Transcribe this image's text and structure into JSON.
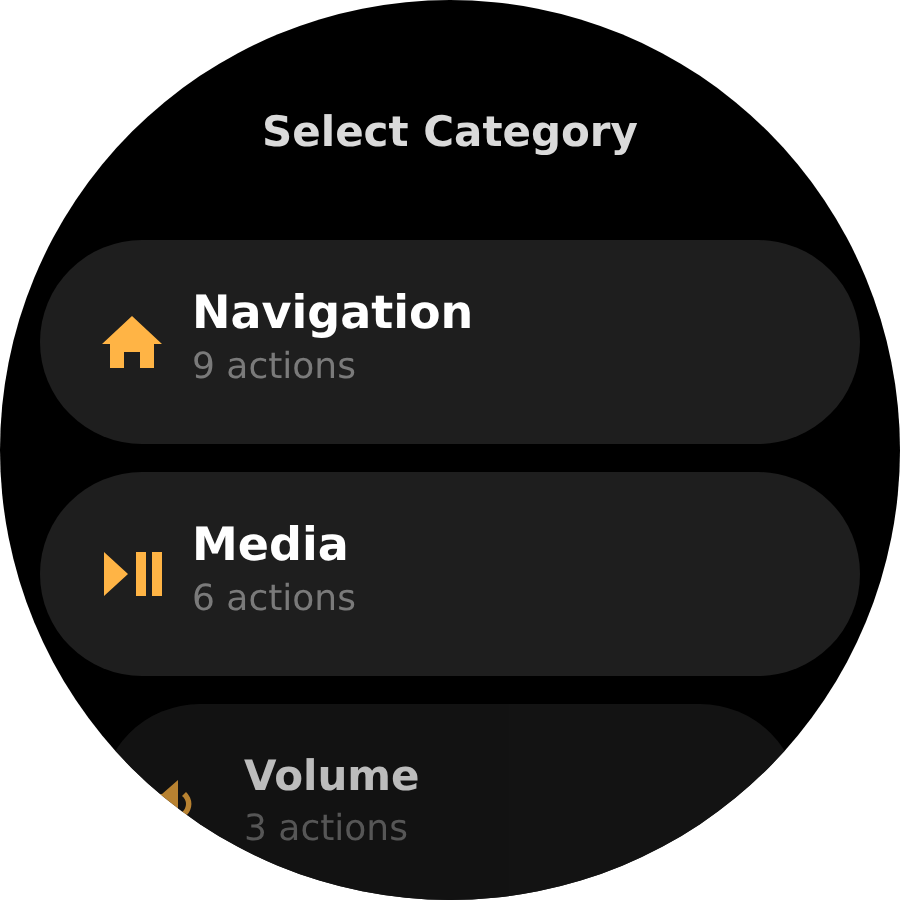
{
  "title": "Select Category",
  "categories": [
    {
      "kind": "home",
      "name": "Navigation",
      "count": "9 actions"
    },
    {
      "kind": "media",
      "name": "Media",
      "count": "6 actions"
    },
    {
      "kind": "volume",
      "name": "Volume",
      "count": "3 actions"
    }
  ]
}
